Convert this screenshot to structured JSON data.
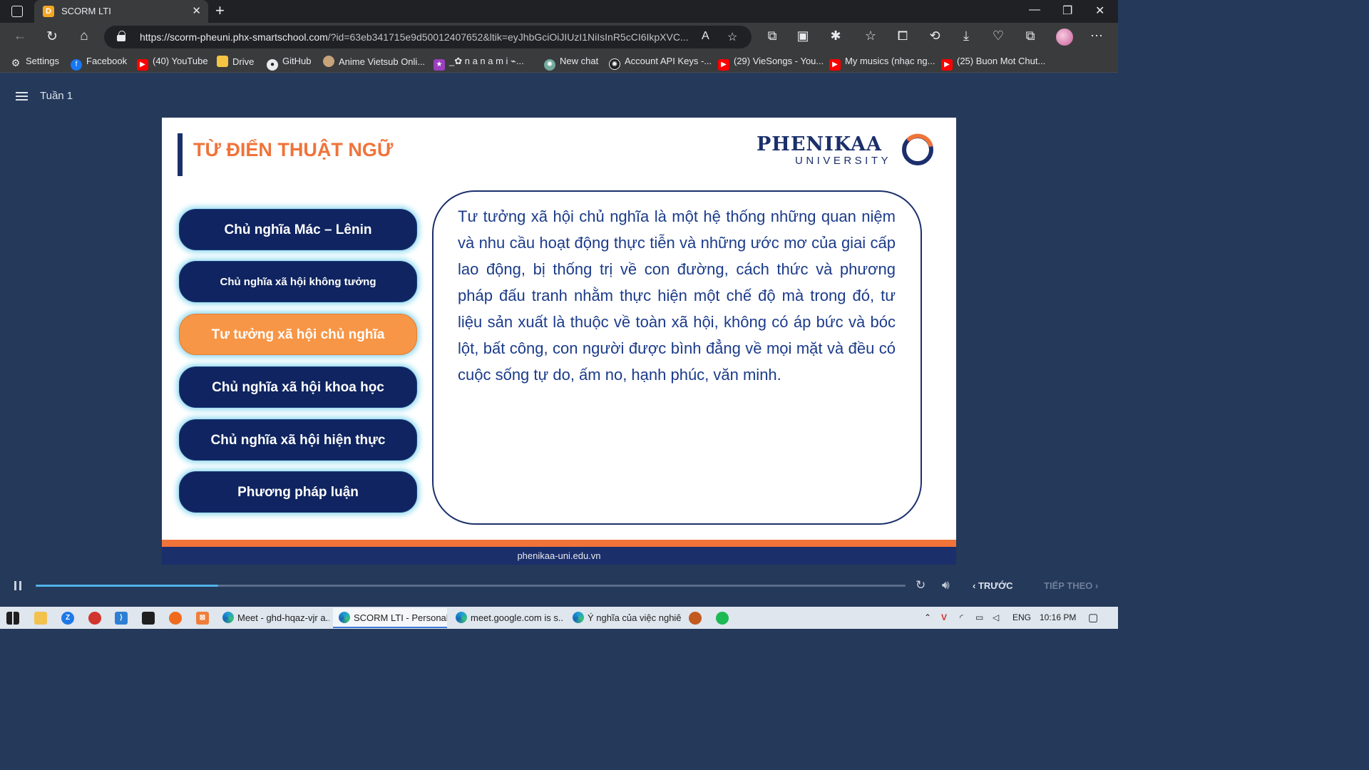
{
  "browser": {
    "tab_title": "SCORM LTI",
    "tab_favicon_letter": "D",
    "url_host": "https://scorm-pheuni.phx-smartschool.com",
    "url_rest": "/?id=63eb341715e9d50012407652&ltik=eyJhbGciOiJIUzI1NiIsInR5cCI6IkpXVC..."
  },
  "bookmarks": [
    {
      "label": "Settings",
      "icon": "gear-icon"
    },
    {
      "label": "Facebook",
      "icon": "facebook-icon"
    },
    {
      "label": "(40) YouTube",
      "icon": "youtube-icon"
    },
    {
      "label": "Drive",
      "icon": "folder-icon"
    },
    {
      "label": "GitHub",
      "icon": "github-icon"
    },
    {
      "label": "Anime Vietsub Onli...",
      "icon": "anime-icon"
    },
    {
      "label": "_✿ n a n a m i ⌁...",
      "icon": "star-icon"
    },
    {
      "label": "New chat",
      "icon": "chatgpt-icon"
    },
    {
      "label": "Account API Keys -...",
      "icon": "openai-icon"
    },
    {
      "label": "(29) VieSongs - You...",
      "icon": "youtube-icon"
    },
    {
      "label": "My musics (nhạc ng...",
      "icon": "youtube-icon"
    },
    {
      "label": "(25) Buon Mot Chut...",
      "icon": "youtube-icon"
    }
  ],
  "player": {
    "week_label": "Tuần 1",
    "prev_label": "TRƯỚC",
    "next_label": "TIẾP THEO",
    "progress": 0.21
  },
  "slide": {
    "title": "TỪ ĐIỂN THUẬT NGỮ",
    "logo_main": "PHENIKAA",
    "logo_sub": "UNIVERSITY",
    "terms": [
      "Chủ nghĩa Mác – Lênin",
      "Chủ nghĩa xã hội không tưởng",
      "Tư tưởng xã hội chủ nghĩa",
      "Chủ nghĩa xã hội khoa học",
      "Chủ nghĩa xã hội hiện thực",
      "Phương pháp luận"
    ],
    "active_term_index": 2,
    "definition": "Tư tưởng xã hội chủ nghĩa là một hệ thống những quan niệm và nhu cầu hoạt động thực tiễn và những ước mơ của giai cấp lao động, bị thống trị về con đường, cách thức và phương pháp đấu tranh nhằm thực hiện một chế độ mà trong đó, tư liệu sản xuất là thuộc về toàn xã hội, không có áp bức và bóc lột, bất công, con người được bình đẳng về mọi mặt và đều có cuộc sống tự do, ấm no, hạnh phúc, văn minh.",
    "footer": "phenikaa-uni.edu.vn"
  },
  "taskbar": {
    "apps": [
      "Meet - ghd-hqaz-vjr a...",
      "SCORM LTI - Personal ...",
      "meet.google.com is s...",
      "Ý nghĩa của việc nghiê..."
    ],
    "language": "ENG",
    "time": "10:16 PM"
  },
  "colors": {
    "accent_orange": "#f0733a",
    "button_navy": "#0f2460",
    "button_active": "#f79646",
    "definition_text": "#1b3b8a"
  }
}
